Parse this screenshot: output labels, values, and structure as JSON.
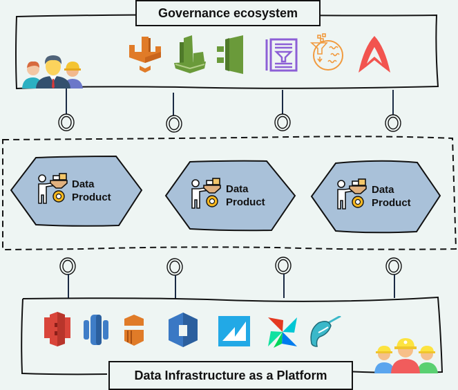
{
  "governance": {
    "title": "Governance ecosystem",
    "people_icon": "governance-team-icon",
    "tools": [
      {
        "name": "aws-lake-formation-icon",
        "color": "#e07b28"
      },
      {
        "name": "aws-cloudwatch-icon",
        "color": "#6a9a3a"
      },
      {
        "name": "aws-cloudtrail-icon",
        "color": "#6a9a3a"
      },
      {
        "name": "data-catalog-icon",
        "color": "#8c5fd6"
      },
      {
        "name": "data-lake-filter-icon",
        "color": "#f19a3e"
      },
      {
        "name": "atlan-icon",
        "color": "#f2544f"
      }
    ]
  },
  "products": {
    "items": [
      {
        "line1": "Data",
        "line2": "Product"
      },
      {
        "line1": "Data",
        "line2": "Product"
      },
      {
        "line1": "Data",
        "line2": "Product"
      }
    ],
    "fill": "#a9c1d9"
  },
  "platform": {
    "title": "Data Infrastructure as a Platform",
    "engineers_icon": "platform-engineers-icon",
    "tools": [
      {
        "name": "aws-s3-icon",
        "color": "#d9453a"
      },
      {
        "name": "aws-redshift-icon",
        "color": "#3f7dc7"
      },
      {
        "name": "aws-kinesis-icon",
        "color": "#e07b28"
      },
      {
        "name": "aws-glue-icon",
        "color": "#3a78c4"
      },
      {
        "name": "metabase-icon",
        "color": "#22a9e6"
      },
      {
        "name": "apache-airflow-icon",
        "color": "#e43921"
      },
      {
        "name": "narwhal-icon",
        "color": "#3bb8c9"
      }
    ]
  }
}
